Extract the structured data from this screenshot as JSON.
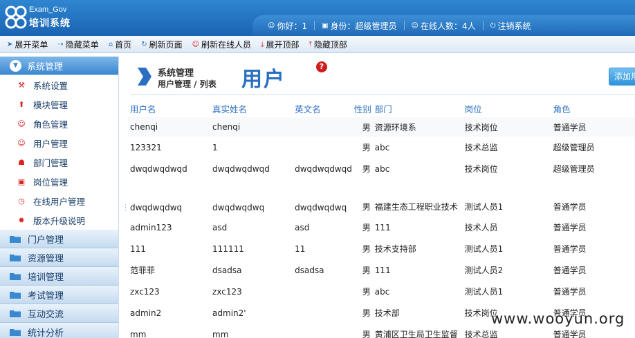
{
  "header": {
    "logo_en": "Exam_Gov",
    "logo_cn": "培训系统",
    "greeting": "你好：1",
    "identity": "身份：超级管理员",
    "online": "在线人数：4人",
    "logout": "注销系统"
  },
  "toolbar": {
    "items": [
      "展开菜单",
      "隐藏菜单",
      "首页",
      "刷新页面",
      "刷新在线人员",
      "展开顶部",
      "隐藏顶部"
    ]
  },
  "sidebar": {
    "active_group": "系统管理",
    "sub_items": [
      "系统设置",
      "模块管理",
      "角色管理",
      "用户管理",
      "部门管理",
      "岗位管理",
      "在线用户管理",
      "版本升级说明"
    ],
    "groups": [
      "门户管理",
      "资源管理",
      "培训管理",
      "考试管理",
      "互动交流",
      "统计分析"
    ]
  },
  "content": {
    "crumb_top": "系统管理",
    "crumb_bottom": "用户管理 / 列表",
    "title": "用户",
    "help": "?",
    "add_button": "添加用户"
  },
  "table": {
    "headers": [
      "用户名",
      "真实姓名",
      "英文名",
      "性别",
      "部门",
      "岗位",
      "角色"
    ],
    "rows": [
      [
        "chenqi",
        "chenqi",
        "",
        "男",
        "资源环境系",
        "技术岗位",
        "普通学员"
      ],
      [
        "123321",
        "1",
        "",
        "男",
        "abc",
        "技术总监",
        "超级管理员"
      ],
      [
        "dwqdwqdwqd",
        "dwqdwqdwqd",
        "dwqdwqdwqd",
        "男",
        "abc",
        "技术岗位",
        "超级管理员"
      ],
      [
        "dwqdwqdwq",
        "dwqdwqdwq",
        "dwqdwqdwq",
        "男",
        "福建生态工程职业技术",
        "测试人员1",
        "普通学员"
      ],
      [
        "admin123",
        "asd",
        "asd",
        "男",
        "111",
        "技术人员",
        "普通学员"
      ],
      [
        "111",
        "111111",
        "11",
        "男",
        "技术支持部",
        "测试人员1",
        "普通学员"
      ],
      [
        "范菲菲",
        "dsadsa",
        "dsadsa",
        "男",
        "111",
        "测试人员2",
        "普通学员"
      ],
      [
        "zxc123",
        "zxc123",
        "",
        "男",
        "abc",
        "测试人员1",
        "普通学员"
      ],
      [
        "admin2",
        "admin2'",
        "",
        "男",
        "技术部",
        "技术岗位",
        "普通学员"
      ],
      [
        "mm",
        "mm",
        "",
        "男",
        "黄浦区卫生局卫生监督",
        "技术总监",
        "普通学员"
      ]
    ]
  },
  "watermark": "www.wooyun.org"
}
